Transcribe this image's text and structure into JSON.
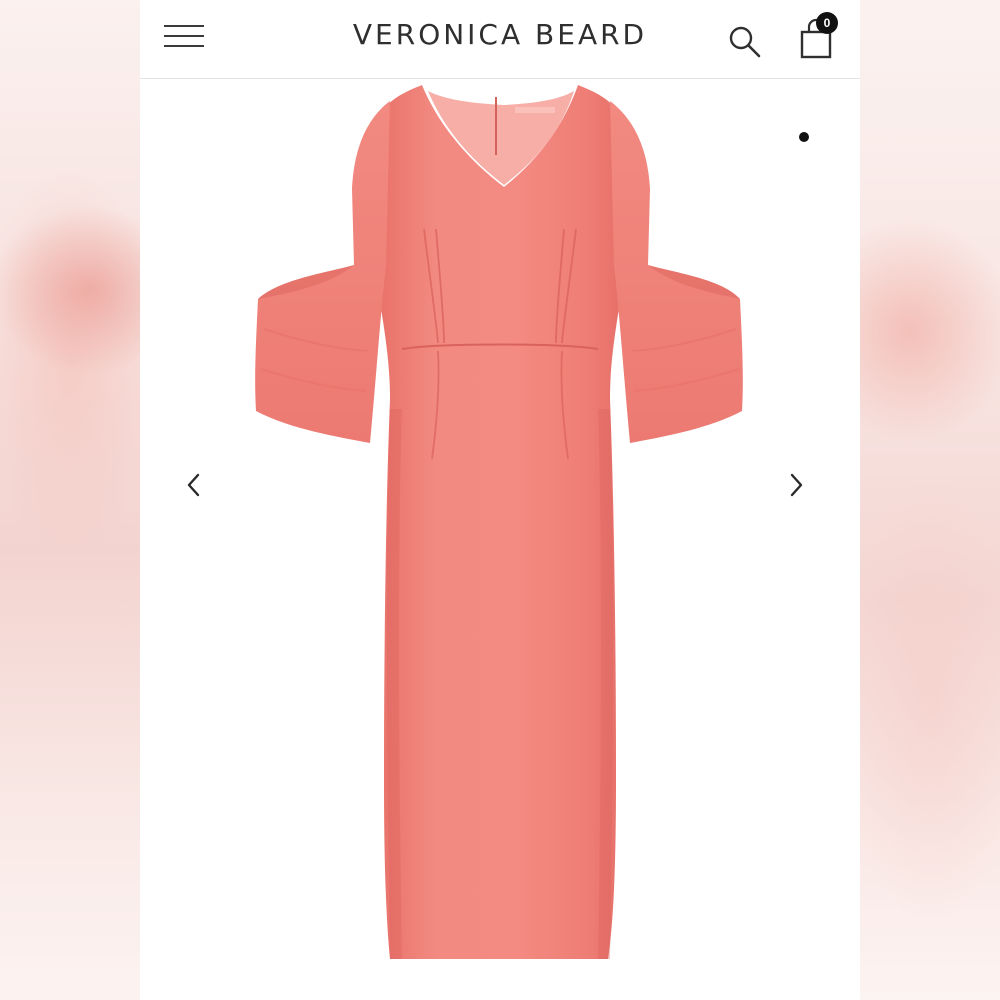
{
  "header": {
    "brand": "VERONICA BEARD",
    "menu_icon": "hamburger-menu-icon",
    "search_icon": "search-icon",
    "bag_icon": "shopping-bag-icon",
    "bag_count": "0"
  },
  "gallery": {
    "product_image": "pink-bell-sleeve-midi-dress",
    "prev_icon": "chevron-left-icon",
    "next_icon": "chevron-right-icon",
    "active_slide": 1
  },
  "colors": {
    "dress": "#F07F78",
    "text": "#2F2F2F",
    "badge": "#111111",
    "background": "#FFFFFF"
  }
}
